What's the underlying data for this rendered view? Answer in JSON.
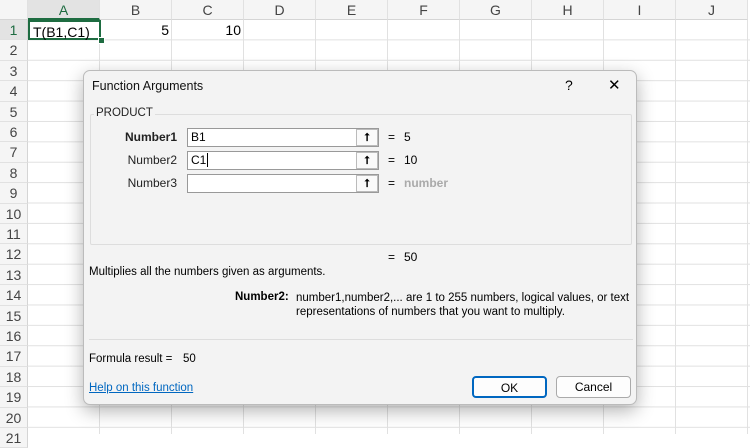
{
  "sheet": {
    "columns": [
      "A",
      "B",
      "C",
      "D",
      "E",
      "F",
      "G",
      "H",
      "I",
      "J"
    ],
    "rows": [
      "1",
      "2",
      "3",
      "4",
      "5",
      "6",
      "7",
      "8",
      "9",
      "10",
      "11",
      "12",
      "13",
      "14",
      "15",
      "16",
      "17",
      "18",
      "19",
      "20",
      "21"
    ],
    "cells": {
      "A1": "T(B1,C1)",
      "B1": "5",
      "C1": "10"
    }
  },
  "dialog": {
    "title": "Function Arguments",
    "help_icon": "?",
    "close_icon": "✕",
    "function_name": "PRODUCT",
    "args": [
      {
        "label": "Number1",
        "value": "B1",
        "result": "5"
      },
      {
        "label": "Number2",
        "value": "C1",
        "result": "10"
      },
      {
        "label": "Number3",
        "value": "",
        "result": "number"
      }
    ],
    "equals": "=",
    "total": "50",
    "description": "Multiplies all the numbers given as arguments.",
    "arg_help_label": "Number2:",
    "arg_help_text": "number1,number2,... are 1 to 255 numbers, logical values, or text representations of numbers that you want to multiply.",
    "formula_result_label": "Formula result =",
    "formula_result": "50",
    "help_link": "Help on this function",
    "ok": "OK",
    "cancel": "Cancel"
  },
  "colors": {
    "accent": "#1e6c41",
    "link": "#0067c0",
    "ok_border": "#0067c0"
  }
}
